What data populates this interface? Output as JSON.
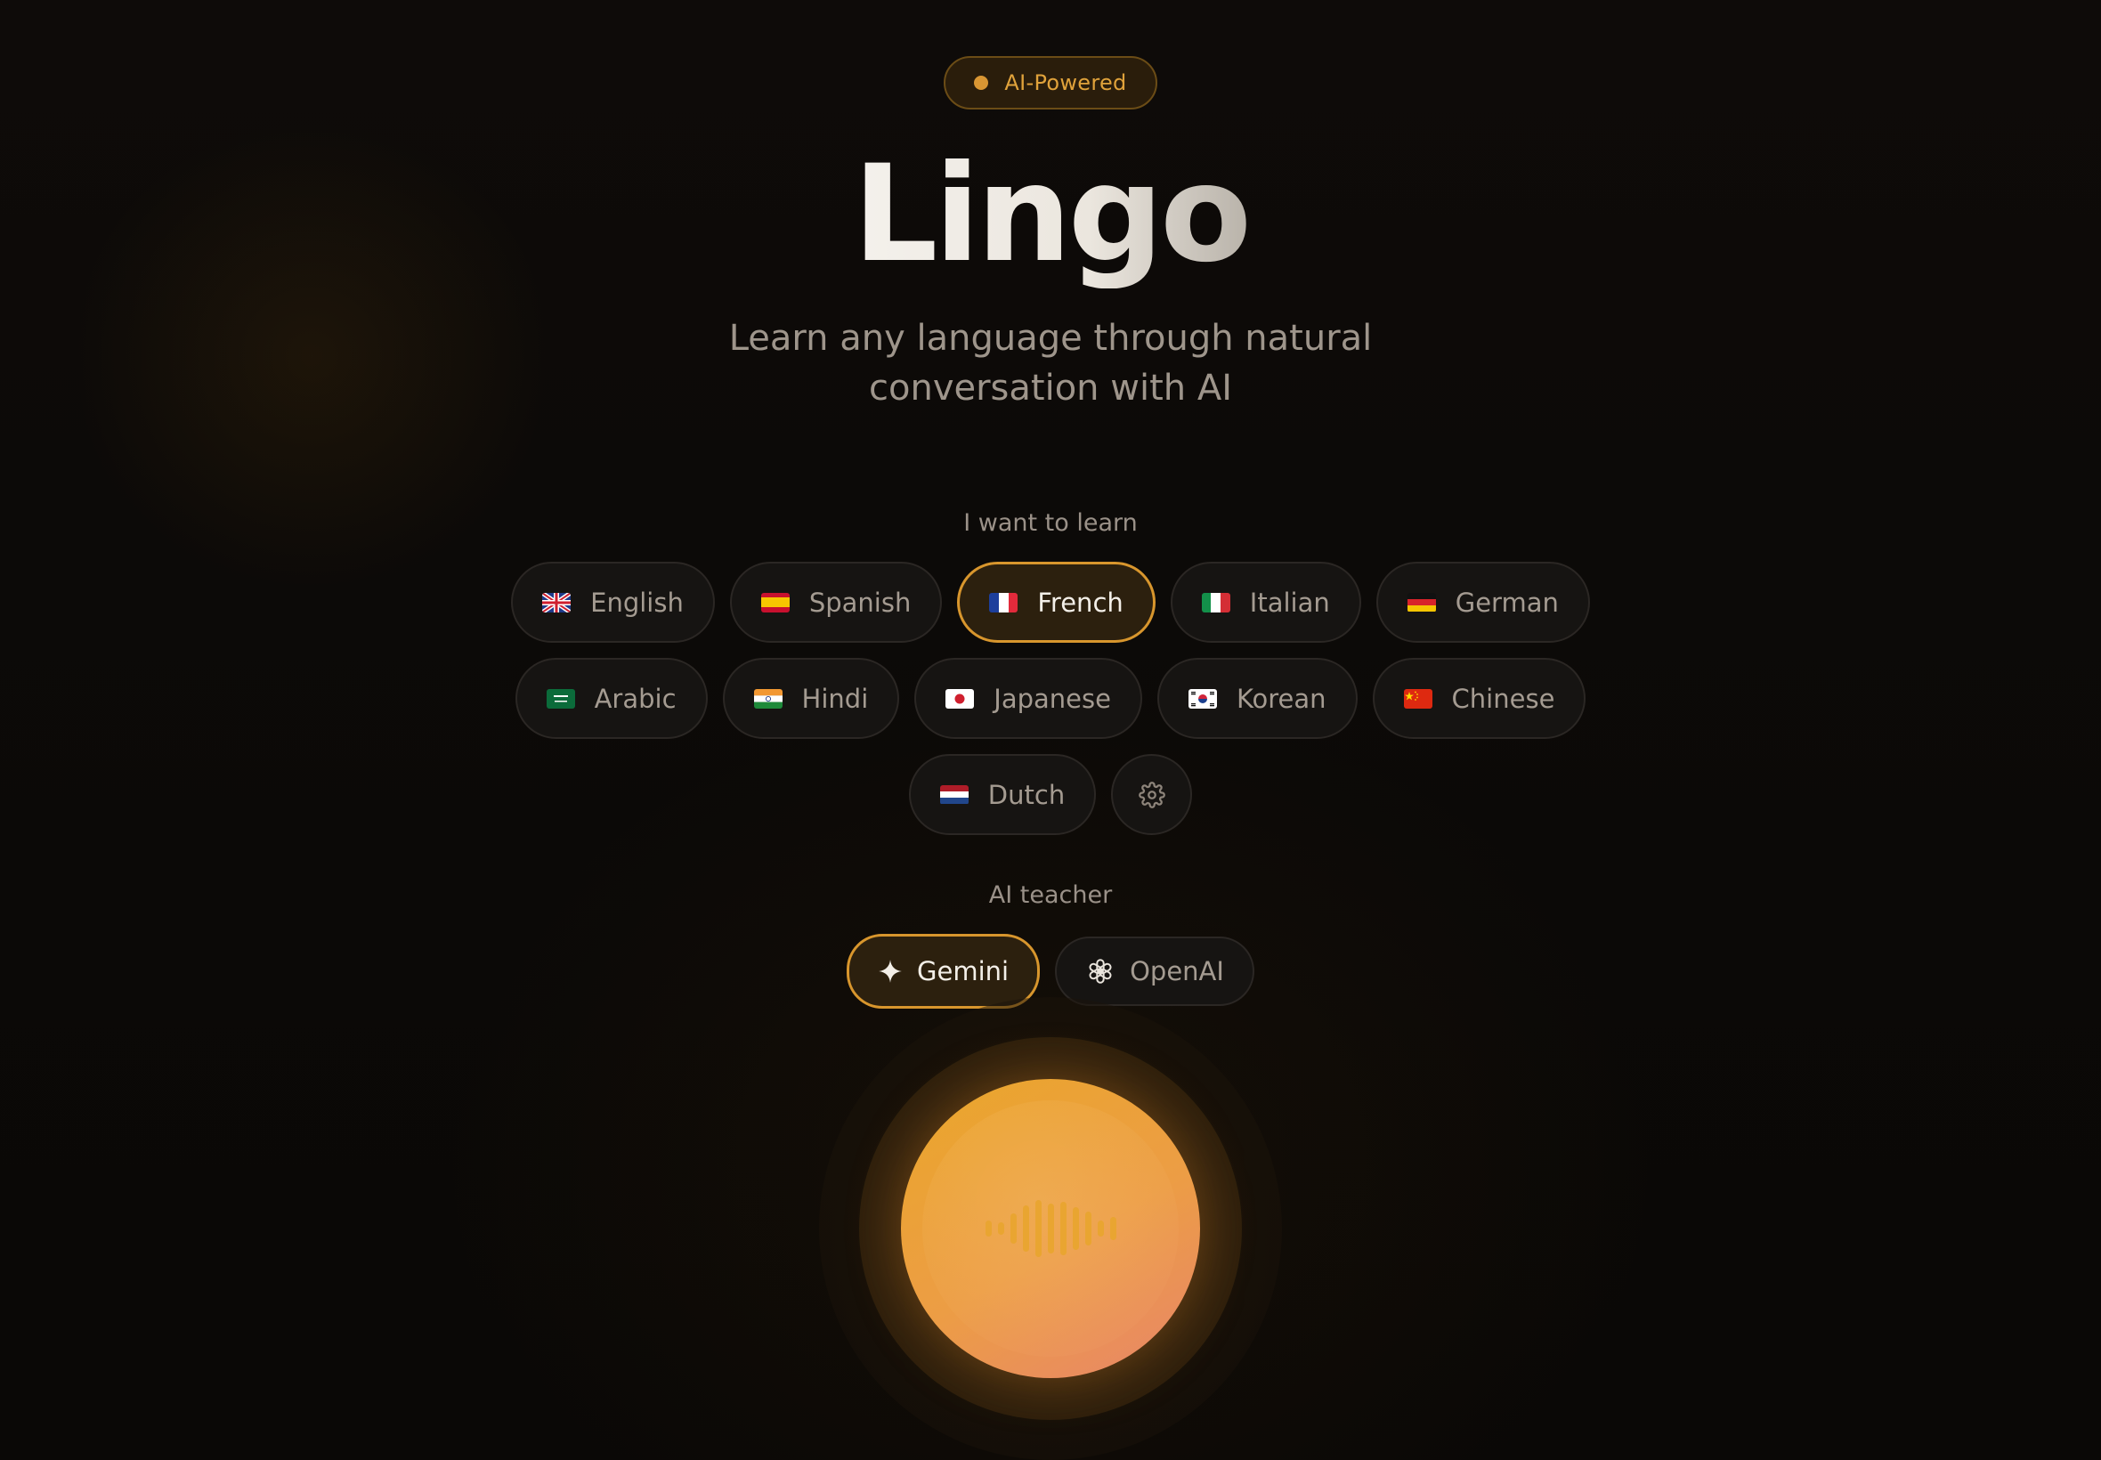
{
  "badge": {
    "label": "AI-Powered"
  },
  "hero": {
    "title": "Lingo",
    "subtitle": "Learn any language through natural conversation with AI"
  },
  "learn": {
    "label": "I want to learn",
    "selected": "French",
    "languages": [
      {
        "label": "English",
        "flag": "uk-flag-icon"
      },
      {
        "label": "Spanish",
        "flag": "spain-flag-icon"
      },
      {
        "label": "French",
        "flag": "france-flag-icon"
      },
      {
        "label": "Italian",
        "flag": "italy-flag-icon"
      },
      {
        "label": "German",
        "flag": "germany-flag-icon"
      },
      {
        "label": "Arabic",
        "flag": "saudi-arabia-flag-icon"
      },
      {
        "label": "Hindi",
        "flag": "india-flag-icon"
      },
      {
        "label": "Japanese",
        "flag": "japan-flag-icon"
      },
      {
        "label": "Korean",
        "flag": "south-korea-flag-icon"
      },
      {
        "label": "Chinese",
        "flag": "china-flag-icon"
      },
      {
        "label": "Dutch",
        "flag": "netherlands-flag-icon"
      }
    ],
    "settings_icon": "gear-icon"
  },
  "teacher": {
    "label": "AI teacher",
    "selected": "Gemini",
    "options": [
      {
        "label": "Gemini",
        "icon": "sparkle-icon"
      },
      {
        "label": "OpenAI",
        "icon": "openai-logo-icon"
      }
    ]
  },
  "mic": {
    "icon": "waveform-icon"
  },
  "colors": {
    "accent": "#d8962d",
    "background": "#0b0907",
    "mic_gradient": [
      "#eaa62a",
      "#e8856a"
    ]
  }
}
